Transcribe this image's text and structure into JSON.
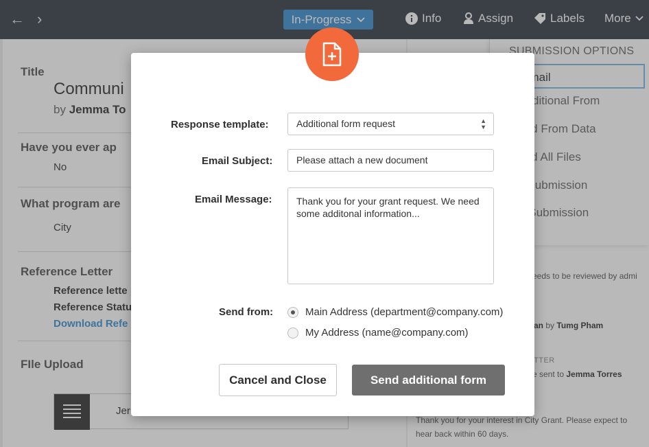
{
  "topbar": {
    "back_icon": "arrow-left-icon",
    "forward_icon": "arrow-right-icon",
    "status_label": "In-Progress",
    "status_color": "#3a8fd0",
    "actions": [
      {
        "label": "Info",
        "icon": "info-icon"
      },
      {
        "label": "Assign",
        "icon": "user-icon"
      },
      {
        "label": "Labels",
        "icon": "tag-icon"
      },
      {
        "label": "More",
        "icon": "chevron-down-icon"
      }
    ]
  },
  "background": {
    "title_label": "Title",
    "title_value": "Communi",
    "by_prefix": "by",
    "by_name": "Jemma To",
    "q1_label": "Have you ever ap",
    "q1_value": "No",
    "q2_label": "What program are",
    "q2_value": "City",
    "ref_label": "Reference Letter",
    "ref_line1": "Reference lette",
    "ref_line2": "Reference Statu",
    "ref_link": "Download Refe",
    "file_label": "FIle Upload",
    "file_name": "Jer"
  },
  "submission_menu": {
    "header": "SUBMISSION OPTIONS",
    "items": [
      "d Email",
      "d Additional From",
      "nload From Data",
      "nload All Files",
      "ive Submission",
      "ate Submission"
    ],
    "selected_index": 0
  },
  "activity": {
    "line1": "eeds to be reviewed by admi",
    "line2_suffix": "an",
    "line2_by": "by",
    "line2_name": "Tumg Pham",
    "line3_tag": "TTER",
    "line4_text": "e sent to",
    "line4_name": "Jemma Torres",
    "line5": "Thank you for your interest in City Grant. Please expect to",
    "line6": "hear back within 60 days."
  },
  "modal": {
    "badge_icon": "add-document-icon",
    "badge_color": "#f26a3b",
    "response_template_label": "Response template:",
    "response_template_value": "Additional form request",
    "email_subject_label": "Email Subject:",
    "email_subject_value": "Please attach a new document",
    "email_message_label": "Email Message:",
    "email_message_value": "Thank you for your grant request. We need some additonal information...",
    "send_from_label": "Send from:",
    "send_from_options": [
      {
        "label": "Main Address (department@company.com)",
        "selected": true
      },
      {
        "label": "My Address (name@company.com)",
        "selected": false
      }
    ],
    "cancel_label": "Cancel and Close",
    "send_label": "Send additional form"
  }
}
